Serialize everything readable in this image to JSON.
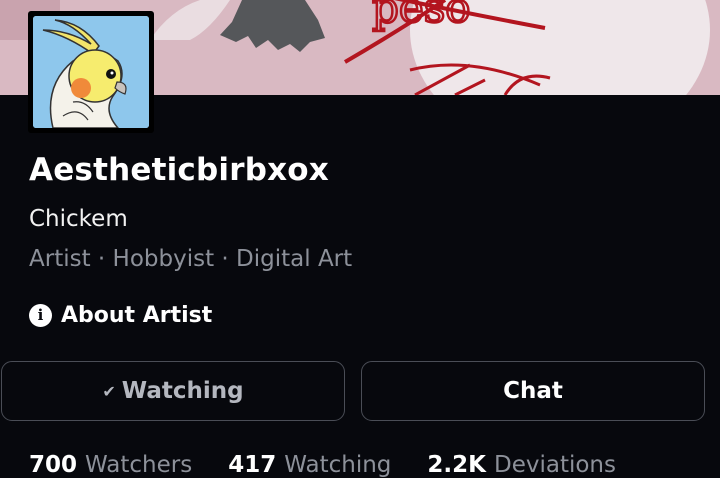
{
  "profile": {
    "username": "Aestheticbirbxox",
    "tagline": "Chickem",
    "meta": "Artist · Hobbyist · Digital Art"
  },
  "about": {
    "label": "About Artist",
    "icon": "info-icon"
  },
  "actions": {
    "watching_label": "Watching",
    "watching_icon": "check-icon",
    "chat_label": "Chat"
  },
  "stats": [
    {
      "value": "700",
      "label": "Watchers"
    },
    {
      "value": "417",
      "label": "Watching"
    },
    {
      "value": "2.2K",
      "label": "Deviations"
    }
  ],
  "banner": {
    "scribble_text": "peso"
  },
  "colors": {
    "background": "#07080d",
    "banner_pink": "#d9b9c2",
    "scribble_red": "#b3151f",
    "muted_text": "#8d919a",
    "button_border": "#4a4d56",
    "avatar_bg": "#8ec7ec"
  }
}
